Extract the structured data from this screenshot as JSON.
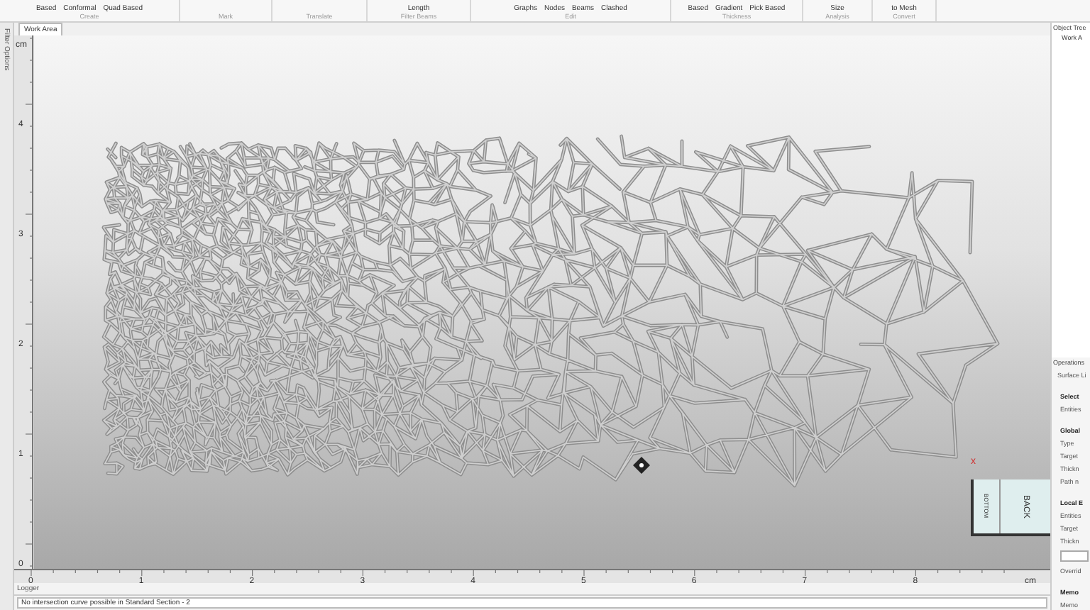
{
  "ribbon": {
    "groups": [
      {
        "label": "Create",
        "buttons": [
          "Based",
          "Conformal",
          "Quad Based"
        ]
      },
      {
        "label": "Mark"
      },
      {
        "label": "Translate"
      },
      {
        "label": "Filter Beams",
        "buttons": [
          "Length"
        ]
      },
      {
        "label": "Edit",
        "buttons": [
          "Graphs",
          "Nodes",
          "Beams",
          "Clashed"
        ]
      },
      {
        "label": "Thickness",
        "buttons": [
          "Based",
          "Gradient",
          "Pick Based"
        ]
      },
      {
        "label": "Analysis",
        "buttons": [
          "Size"
        ]
      },
      {
        "label": "Convert",
        "buttons": [
          "to Mesh"
        ]
      }
    ]
  },
  "left_strip": {
    "label": "Filter Options"
  },
  "tabs": [
    {
      "label": "Work Area",
      "selected": true
    }
  ],
  "viewport": {
    "y_unit": "cm",
    "y_labels": [
      "4",
      "3",
      "2",
      "1",
      "0"
    ],
    "x_labels": [
      "0",
      "1",
      "2",
      "3",
      "4",
      "5",
      "6",
      "7",
      "8"
    ],
    "x_unit": "cm",
    "axis_marker": "x",
    "view_cube": {
      "front": "BACK",
      "side": "BOTTOM"
    }
  },
  "right_panel": {
    "tree_title": "Object Tree",
    "tree_items": [
      "Work A"
    ],
    "operations_title": "Operations",
    "operations_subtitle": "Surface Li",
    "rows": [
      {
        "kind": "section",
        "text": "Select"
      },
      {
        "kind": "label",
        "text": "Entities"
      },
      {
        "kind": "section",
        "text": "Global"
      },
      {
        "kind": "label",
        "text": "Type"
      },
      {
        "kind": "label",
        "text": "Target"
      },
      {
        "kind": "label",
        "text": "Thickn"
      },
      {
        "kind": "label",
        "text": "Path n"
      },
      {
        "kind": "section",
        "text": "Local E"
      },
      {
        "kind": "label",
        "text": "Entities"
      },
      {
        "kind": "label",
        "text": "Target"
      },
      {
        "kind": "label",
        "text": "Thickn"
      },
      {
        "kind": "field"
      },
      {
        "kind": "label",
        "text": "Overrid"
      },
      {
        "kind": "section",
        "text": "Memo"
      },
      {
        "kind": "label",
        "text": "Memo"
      }
    ]
  },
  "logger": {
    "title": "Logger",
    "message": "No intersection curve possible in Standard Section - 2"
  }
}
